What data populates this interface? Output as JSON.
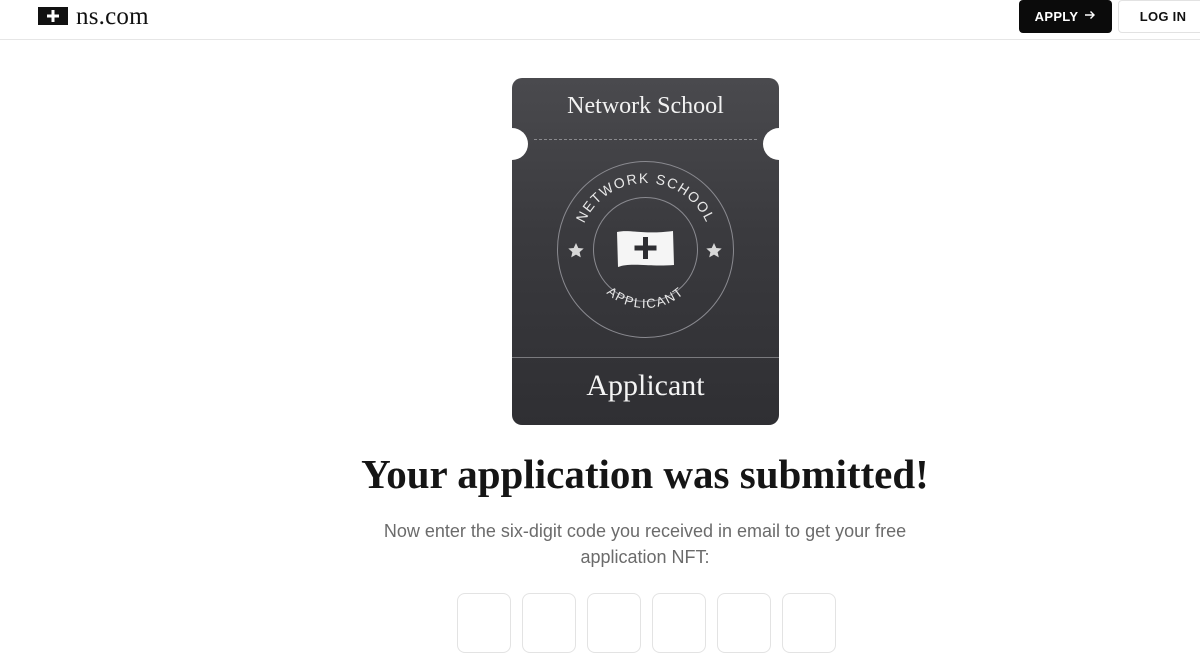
{
  "header": {
    "logo_text": "ns.com",
    "logo_icon": "plus-flag-icon",
    "apply_label": "APPLY",
    "apply_icon": "arrow-right-icon",
    "login_label": "LOG IN"
  },
  "ticket": {
    "title": "Network School",
    "emblem_top_text": "NETWORK SCHOOL",
    "emblem_bottom_text": "APPLICANT",
    "footer_label": "Applicant"
  },
  "main": {
    "headline": "Your application was submitted!",
    "instructions": "Now enter the six-digit code you received in email to get your free application NFT:",
    "code_inputs": [
      "",
      "",
      "",
      "",
      "",
      ""
    ]
  },
  "colors": {
    "accent": "#0b0b0b",
    "ticket_top": "#4a4a4e",
    "ticket_bottom": "#2f2f33",
    "muted_text": "#6b6b6b"
  }
}
